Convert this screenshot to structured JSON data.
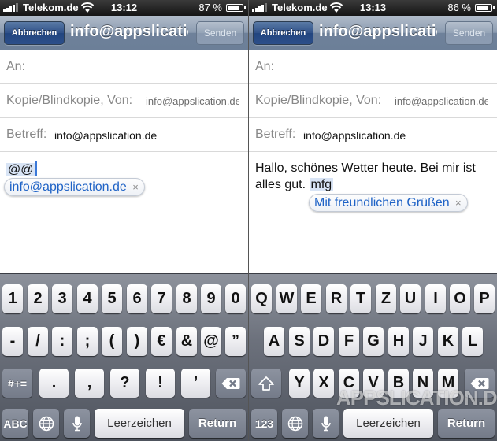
{
  "left": {
    "status": {
      "carrier": "Telekom.de",
      "time": "13:12",
      "battery": "87 %"
    },
    "nav": {
      "cancel": "Abbrechen",
      "title": "info@appslication.de",
      "send": "Senden"
    },
    "fields": {
      "to_label": "An:",
      "cc_label": "Kopie/Blindkopie, Von:",
      "cc_value": "info@appslication.de",
      "subject_label": "Betreff:",
      "subject_value": "info@appslication.de"
    },
    "body": {
      "typed": "@@",
      "suggestion": "info@appslication.de"
    },
    "keyboard": {
      "row1": [
        "1",
        "2",
        "3",
        "4",
        "5",
        "6",
        "7",
        "8",
        "9",
        "0"
      ],
      "row2": [
        "-",
        "/",
        ":",
        ";",
        "(",
        ")",
        "€",
        "&",
        "@",
        "”"
      ],
      "row3_left": "#+=",
      "row3": [
        ".",
        ",",
        "?",
        "!",
        "’"
      ],
      "row4": {
        "mode": "ABC",
        "space": "Leerzeichen",
        "return": "Return"
      }
    }
  },
  "right": {
    "status": {
      "carrier": "Telekom.de",
      "time": "13:13",
      "battery": "86 %"
    },
    "nav": {
      "cancel": "Abbrechen",
      "title": "info@appslication.de",
      "send": "Senden"
    },
    "fields": {
      "to_label": "An:",
      "cc_label": "Kopie/Blindkopie, Von:",
      "cc_value": "info@appslication.de",
      "subject_label": "Betreff:",
      "subject_value": "info@appslication.de"
    },
    "body": {
      "line1": "Hallo, schönes Wetter heute. Bei mir ist",
      "line2": "alles gut.",
      "typed": "mfg",
      "suggestion": "Mit freundlichen Grüßen"
    },
    "keyboard": {
      "row1": [
        "Q",
        "W",
        "E",
        "R",
        "T",
        "Z",
        "U",
        "I",
        "O",
        "P"
      ],
      "row2": [
        "A",
        "S",
        "D",
        "F",
        "G",
        "H",
        "J",
        "K",
        "L"
      ],
      "row3": [
        "Y",
        "X",
        "C",
        "V",
        "B",
        "N",
        "M"
      ],
      "row4": {
        "mode": "123",
        "space": "Leerzeichen",
        "return": "Return"
      }
    }
  },
  "watermark": "APPSLICATION.DE",
  "icons": [
    "signal-icon",
    "wifi-icon",
    "battery-icon",
    "backspace-icon",
    "shift-icon",
    "globe-icon",
    "microphone-icon",
    "close-icon"
  ],
  "colors": {
    "nav_blue": "#2f5088",
    "link_blue": "#1f63c6",
    "keyboard_bg": "#6c717c"
  }
}
